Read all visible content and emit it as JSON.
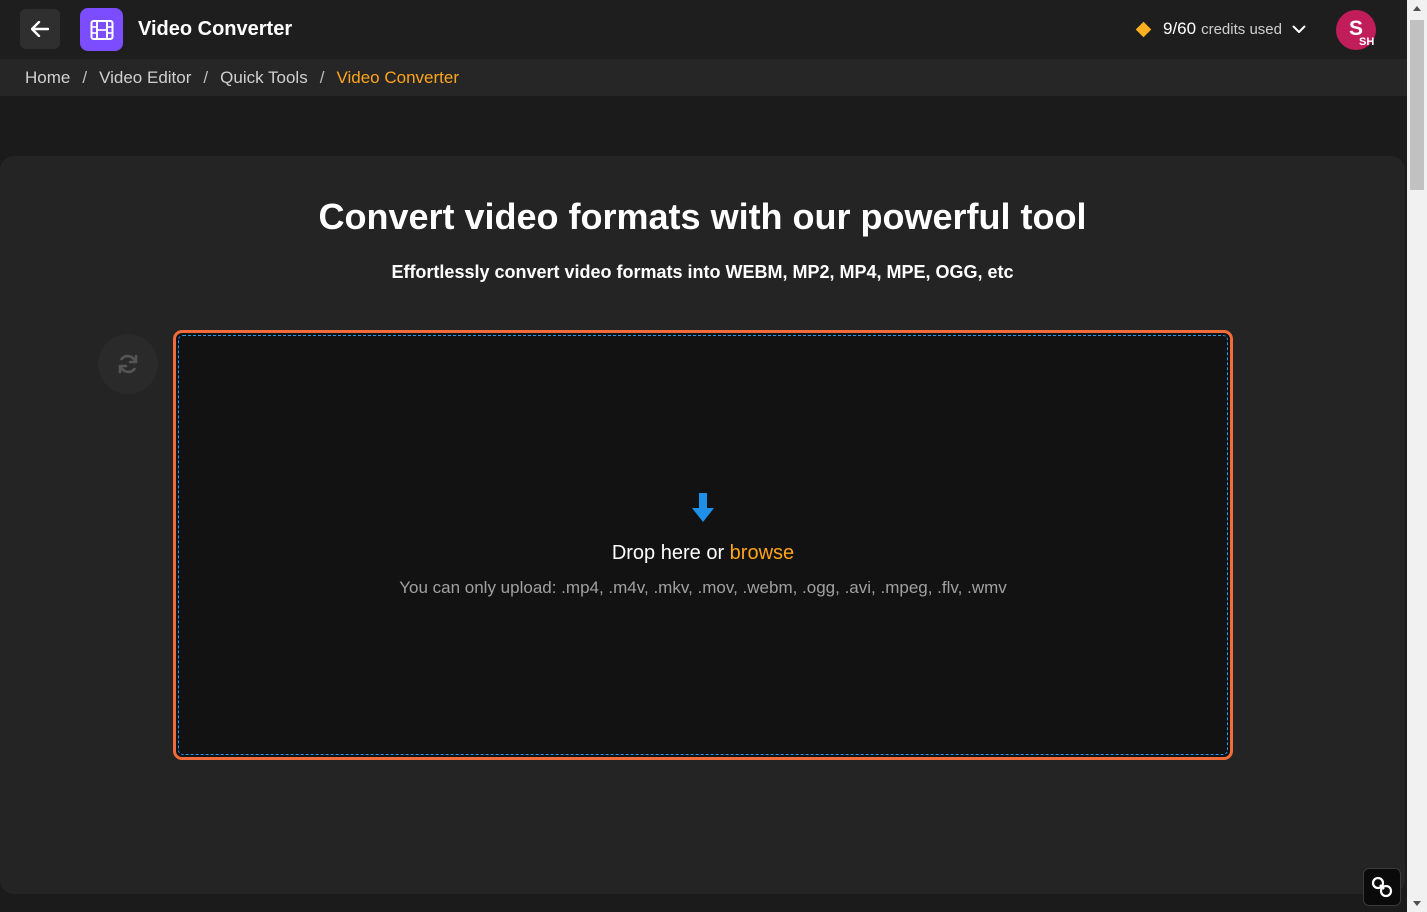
{
  "header": {
    "app_title": "Video Converter",
    "back_icon": "arrow-left-icon",
    "app_icon": "film-icon",
    "credits": {
      "count": "9/60",
      "label": "credits used"
    },
    "avatar": {
      "letter": "S",
      "initials": "SH",
      "color": "#c21d5b"
    }
  },
  "breadcrumb": {
    "items": [
      "Home",
      "Video Editor",
      "Quick Tools",
      "Video Converter"
    ],
    "separator": "/"
  },
  "main": {
    "headline": "Convert video formats with our powerful tool",
    "subheadline": "Effortlessly convert video formats into WEBM, MP2, MP4, MPE, OGG, etc",
    "dropzone": {
      "text": "Drop here or",
      "browse_label": "browse",
      "hint": "You can only upload: .mp4, .m4v, .mkv, .mov, .webm, .ogg, .avi, .mpeg, .flv, .wmv"
    }
  },
  "colors": {
    "accent": "#ffa41b",
    "app_icon_bg": "#7c4dff",
    "dropzone_border": "#f26b3a",
    "dropzone_dash": "#2196f3"
  }
}
